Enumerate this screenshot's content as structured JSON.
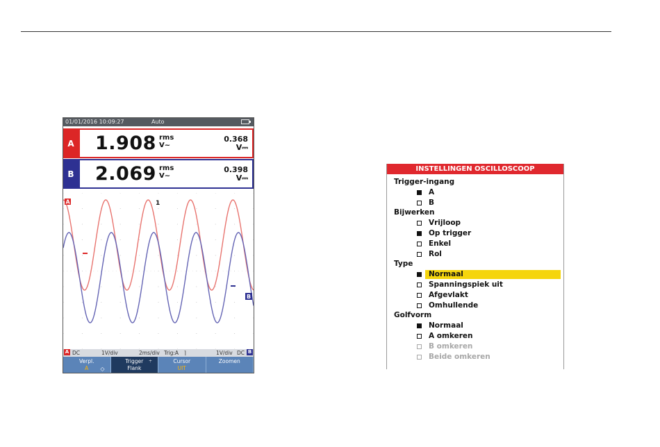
{
  "scope": {
    "status": {
      "datetime": "01/01/2016 10:09:27",
      "mode": "Auto"
    },
    "channel_a": {
      "label": "A",
      "value": "1.908",
      "unit_top": "rms",
      "unit_bottom": "V~",
      "dc_value": "0.368",
      "dc_unit": "V⎓",
      "color": "#dc2626"
    },
    "channel_b": {
      "label": "B",
      "value": "2.069",
      "unit_top": "rms",
      "unit_bottom": "V~",
      "dc_value": "0.398",
      "dc_unit": "V⎓",
      "color": "#2e3192"
    },
    "plot": {
      "marker_a": "A",
      "marker_b": "B",
      "trigger_marker": "1"
    },
    "scale": {
      "a_label": "A",
      "a_coupling": "DC",
      "a_vdiv": "1V/div",
      "timebase": "2ms/div",
      "trig": "Trig:A",
      "trig_icon": "⌉",
      "b_vdiv": "1V/div",
      "b_coupling": "DC",
      "b_label": "B"
    },
    "softkeys": [
      {
        "label": "Verpl.",
        "sub": "A",
        "icon": "◇"
      },
      {
        "label": "Trigger",
        "sub": "Flank",
        "icon": "÷"
      },
      {
        "label": "Cursor",
        "sub": "UIT"
      },
      {
        "label": "Zoomen",
        "sub": ""
      }
    ]
  },
  "menu": {
    "title": "INSTELLINGEN OSCILLOSCOOP",
    "rows": [
      {
        "kind": "head",
        "text": "Trigger-ingang"
      },
      {
        "kind": "opt",
        "text": "A",
        "checked": true
      },
      {
        "kind": "opt",
        "text": "B",
        "checked": false
      },
      {
        "kind": "head",
        "text": "Bijwerken"
      },
      {
        "kind": "opt",
        "text": "Vrijloop",
        "checked": false
      },
      {
        "kind": "opt",
        "text": "Op trigger",
        "checked": true
      },
      {
        "kind": "opt",
        "text": "Enkel",
        "checked": false
      },
      {
        "kind": "opt",
        "text": "Rol",
        "checked": false
      },
      {
        "kind": "head",
        "text": "Type"
      },
      {
        "kind": "opt",
        "text": "Normaal",
        "checked": true,
        "selected": true
      },
      {
        "kind": "opt",
        "text": "Spanningspiek uit",
        "checked": false
      },
      {
        "kind": "opt",
        "text": "Afgevlakt",
        "checked": false
      },
      {
        "kind": "opt",
        "text": "Omhullende",
        "checked": false
      },
      {
        "kind": "head",
        "text": "Golfvorm"
      },
      {
        "kind": "opt",
        "text": "Normaal",
        "checked": true
      },
      {
        "kind": "opt",
        "text": "A omkeren",
        "checked": false
      },
      {
        "kind": "opt",
        "text": "B omkeren",
        "checked": false,
        "disabled": true
      },
      {
        "kind": "opt",
        "text": "Beide omkeren",
        "checked": false,
        "disabled": true
      }
    ]
  }
}
